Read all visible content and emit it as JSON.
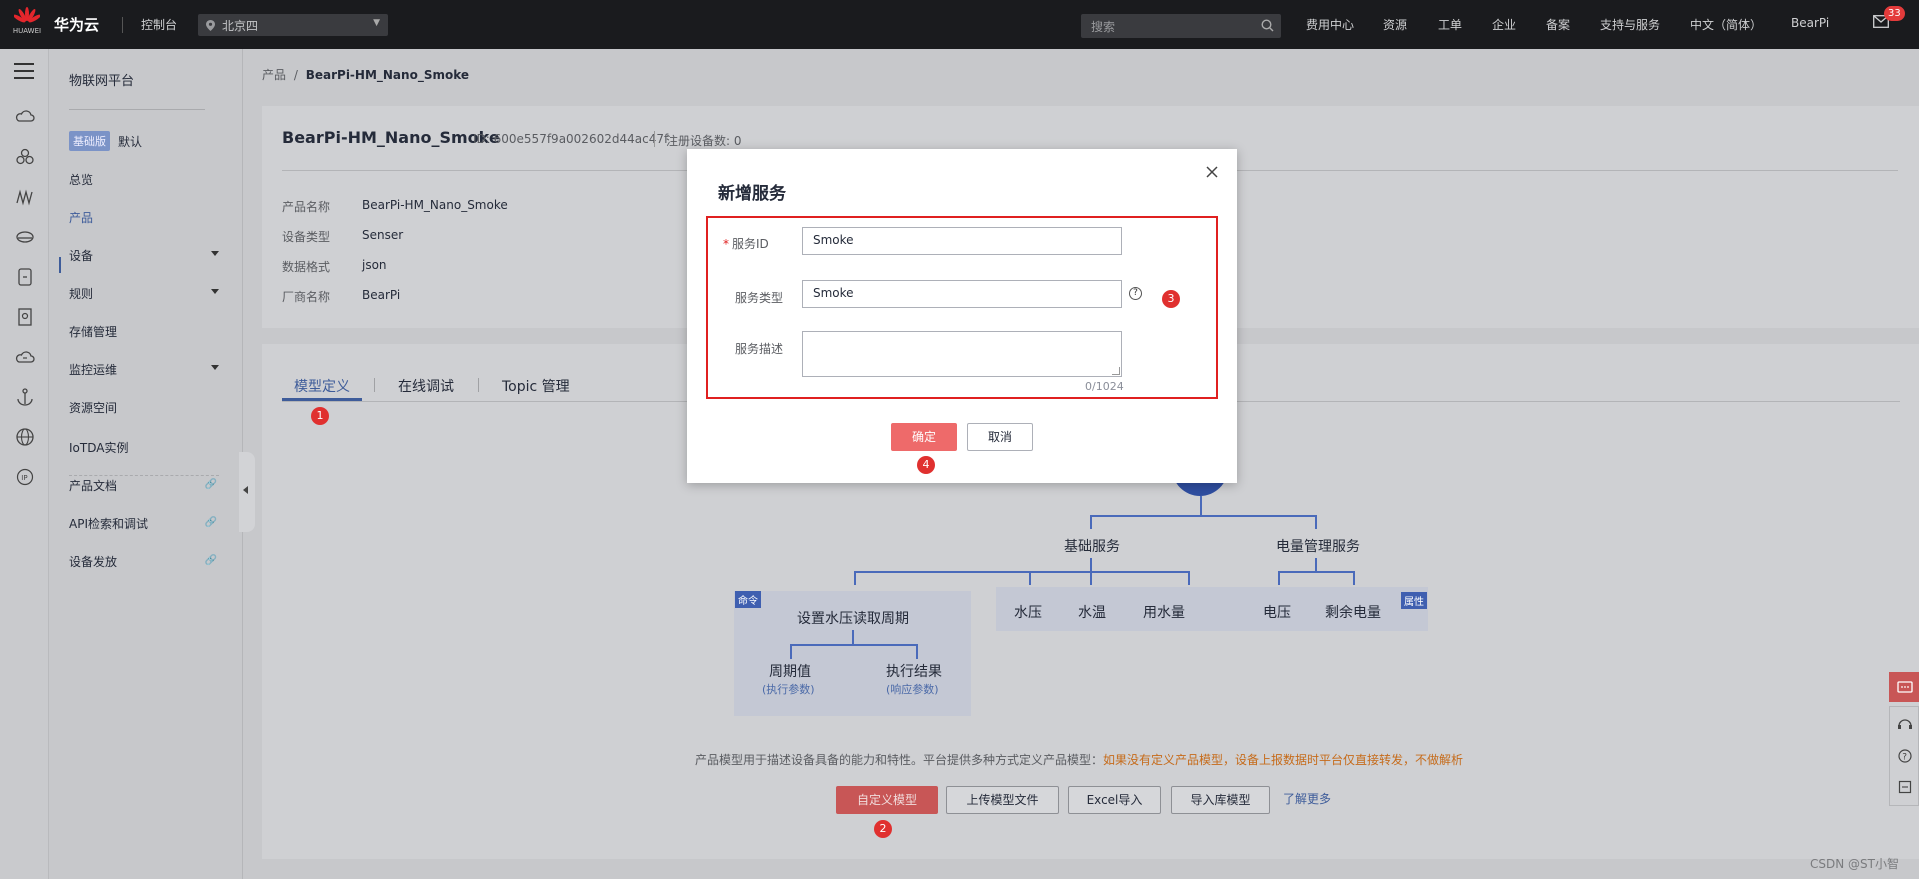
{
  "header": {
    "brand": "华为云",
    "logo_text": "HUAWEI",
    "console": "控制台",
    "region": "北京四",
    "search_placeholder": "搜索",
    "links": [
      "费用中心",
      "资源",
      "工单",
      "企业",
      "备案",
      "支持与服务",
      "中文（简体）",
      "BearPi"
    ],
    "mail_count": "33"
  },
  "sidebar": {
    "title": "物联网平台",
    "edition_tag": "基础版",
    "edition_name": "默认",
    "items": [
      "总览",
      "产品",
      "设备",
      "规则",
      "存储管理",
      "监控运维",
      "资源空间",
      "IoTDA实例",
      "产品文档",
      "API检索和调试",
      "设备发放"
    ]
  },
  "breadcrumb": {
    "parent": "产品",
    "sep": "/",
    "current": "BearPi-HM_Nano_Smoke"
  },
  "product": {
    "name": "BearPi-HM_Nano_Smoke",
    "id_text": "ID: 600e557f9a002602d44ac47f",
    "devices_text": "注册设备数: 0",
    "fields": [
      {
        "label": "产品名称",
        "value": "BearPi-HM_Nano_Smoke"
      },
      {
        "label": "设备类型",
        "value": "Senser"
      },
      {
        "label": "数据格式",
        "value": "json"
      },
      {
        "label": "厂商名称",
        "value": "BearPi"
      }
    ]
  },
  "tabs": [
    "模型定义",
    "在线调试",
    "Topic 管理"
  ],
  "steps": [
    "1",
    "2",
    "3",
    "4"
  ],
  "diagram": {
    "basic_service": "基础服务",
    "power_service": "电量管理服务",
    "cmd_tag": "命令",
    "attr_tag": "属性",
    "command": "设置水压读取周期",
    "param1": "周期值",
    "param1_sub": "(执行参数)",
    "param2": "执行结果",
    "param2_sub": "(响应参数)",
    "props": [
      "水压",
      "水温",
      "用水量",
      "电压",
      "剩余电量"
    ]
  },
  "hint": {
    "text": "产品模型用于描述设备具备的能力和特性。平台提供多种方式定义产品模型：",
    "warn": "如果没有定义产品模型，设备上报数据时平台仅直接转发，不做解析"
  },
  "actions": [
    "自定义模型",
    "上传模型文件",
    "Excel导入",
    "导入库模型"
  ],
  "learn_more": "了解更多",
  "modal": {
    "title": "新增服务",
    "service_id_label": "服务ID",
    "service_id_value": "Smoke",
    "service_type_label": "服务类型",
    "service_type_value": "Smoke",
    "service_desc_label": "服务描述",
    "desc_count": "0/1024",
    "ok": "确定",
    "cancel": "取消"
  },
  "watermark": "CSDN @ST小智"
}
